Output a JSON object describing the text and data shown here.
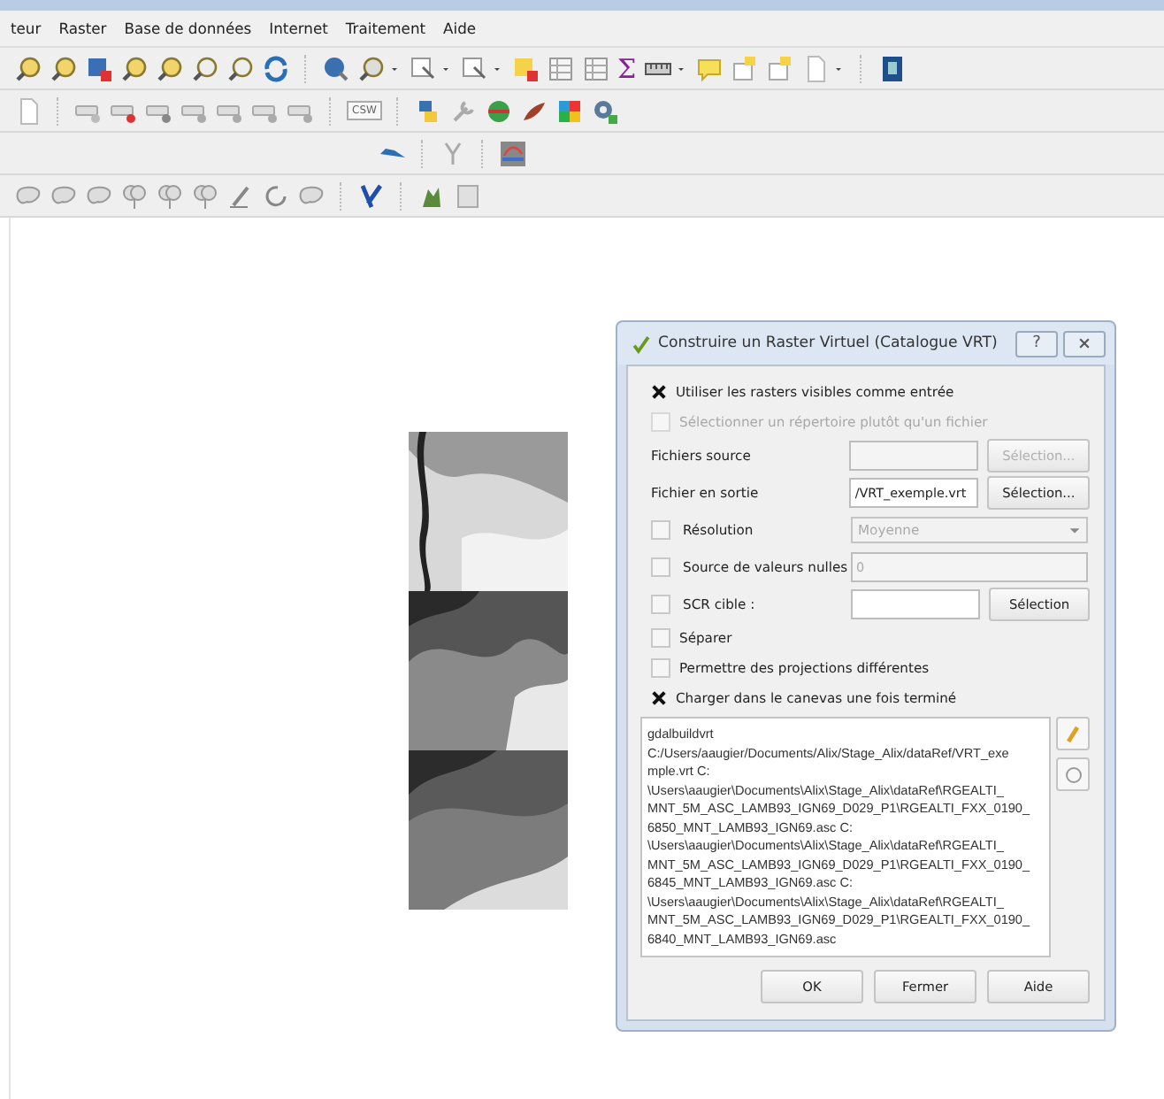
{
  "menu": [
    {
      "label": "teur"
    },
    {
      "label": "Raster"
    },
    {
      "label": "Base de données"
    },
    {
      "label": "Internet"
    },
    {
      "label": "Traitement"
    },
    {
      "label": "Aide"
    }
  ],
  "toolbar_texts": {
    "sum": "Σ",
    "csw": "CSW"
  },
  "dialog": {
    "title": "Construire un Raster Virtuel (Catalogue VRT)",
    "help_button": "?",
    "rows": [
      {
        "kind": "checkbox",
        "label": "Utiliser les rasters visibles comme entrée",
        "checked": true,
        "disabled": false
      },
      {
        "kind": "checkbox",
        "label": "Sélectionner un répertoire plutôt qu'un fichier",
        "checked": false,
        "disabled": true
      },
      {
        "kind": "file",
        "label": "Fichiers source",
        "button": "Sélection...",
        "disabled": true
      },
      {
        "kind": "file",
        "label": "Fichier en sortie",
        "value": "/VRT_exemple.vrt",
        "button": "Sélection...",
        "disabled": false
      },
      {
        "kind": "combo",
        "label": "Résolution",
        "checked": false,
        "value": "Moyenne"
      },
      {
        "kind": "text",
        "label": "Source de valeurs nulles",
        "checked": false,
        "value": "0"
      },
      {
        "kind": "crs",
        "label": "SCR cible :",
        "checked": false,
        "button": "Sélection"
      },
      {
        "kind": "checkbox",
        "label": "Séparer",
        "checked": false,
        "disabled": false
      },
      {
        "kind": "checkbox",
        "label": "Permettre des projections différentes",
        "checked": false,
        "disabled": false
      },
      {
        "kind": "checkbox",
        "label": "Charger dans le canevas une fois terminé",
        "checked": true,
        "disabled": false
      }
    ],
    "command_lines": [
      "gdalbuildvrt",
      "C:/Users/aaugier/Documents/Alix/Stage_Alix/dataRef/VRT_exe",
      "mple.vrt C:",
      "\\Users\\aaugier\\Documents\\Alix\\Stage_Alix\\dataRef\\RGEALTI_",
      "MNT_5M_ASC_LAMB93_IGN69_D029_P1\\RGEALTI_FXX_0190_",
      "6850_MNT_LAMB93_IGN69.asc C:",
      "\\Users\\aaugier\\Documents\\Alix\\Stage_Alix\\dataRef\\RGEALTI_",
      "MNT_5M_ASC_LAMB93_IGN69_D029_P1\\RGEALTI_FXX_0190_",
      "6845_MNT_LAMB93_IGN69.asc C:",
      "\\Users\\aaugier\\Documents\\Alix\\Stage_Alix\\dataRef\\RGEALTI_",
      "MNT_5M_ASC_LAMB93_IGN69_D029_P1\\RGEALTI_FXX_0190_",
      "6840_MNT_LAMB93_IGN69.asc"
    ],
    "buttons": [
      "OK",
      "Fermer",
      "Aide"
    ]
  }
}
